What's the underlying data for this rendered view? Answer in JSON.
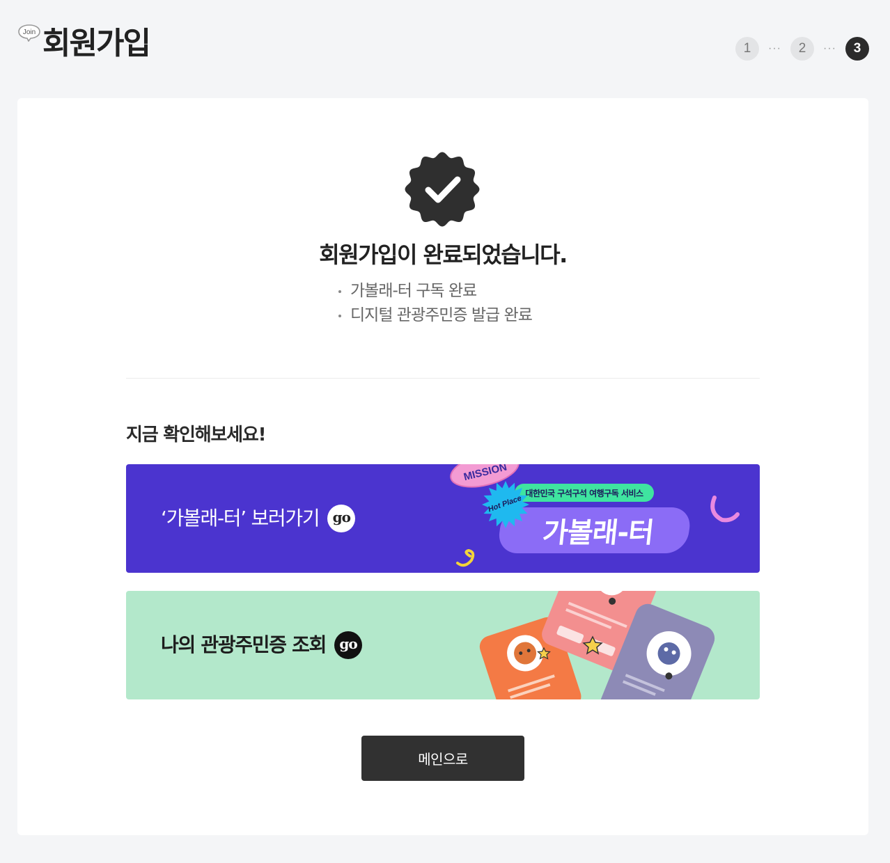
{
  "header": {
    "badge_text": "Join",
    "title": "회원가입",
    "steps": [
      {
        "label": "1",
        "state": "done"
      },
      {
        "label": "2",
        "state": "done"
      },
      {
        "label": "3",
        "state": "current"
      }
    ],
    "step_separator": "···"
  },
  "complete": {
    "icon": "check-badge-icon",
    "title": "회원가입이 완료되었습니다.",
    "items": [
      "가볼래-터 구독 완료",
      "디지털 관광주민증 발급 완료"
    ]
  },
  "recommend": {
    "heading": "지금 확인해보세요!",
    "banners": [
      {
        "label": "‘가볼래-터’ 보러가기",
        "go": "go",
        "bg_color": "#4b34cf",
        "art": {
          "mission": "MISSION",
          "hot_place": "Hot Place",
          "tagline": "대한민국 구석구석 여행구독 서비스",
          "logo": "가볼래-터"
        }
      },
      {
        "label": "나의 관광주민증 조회",
        "go": "go",
        "bg_color": "#b3e8cb"
      }
    ]
  },
  "main_button": "메인으로",
  "colors": {
    "background": "#f4f5f7",
    "dark": "#313131",
    "purple": "#4b34cf",
    "mint": "#b3e8cb"
  }
}
